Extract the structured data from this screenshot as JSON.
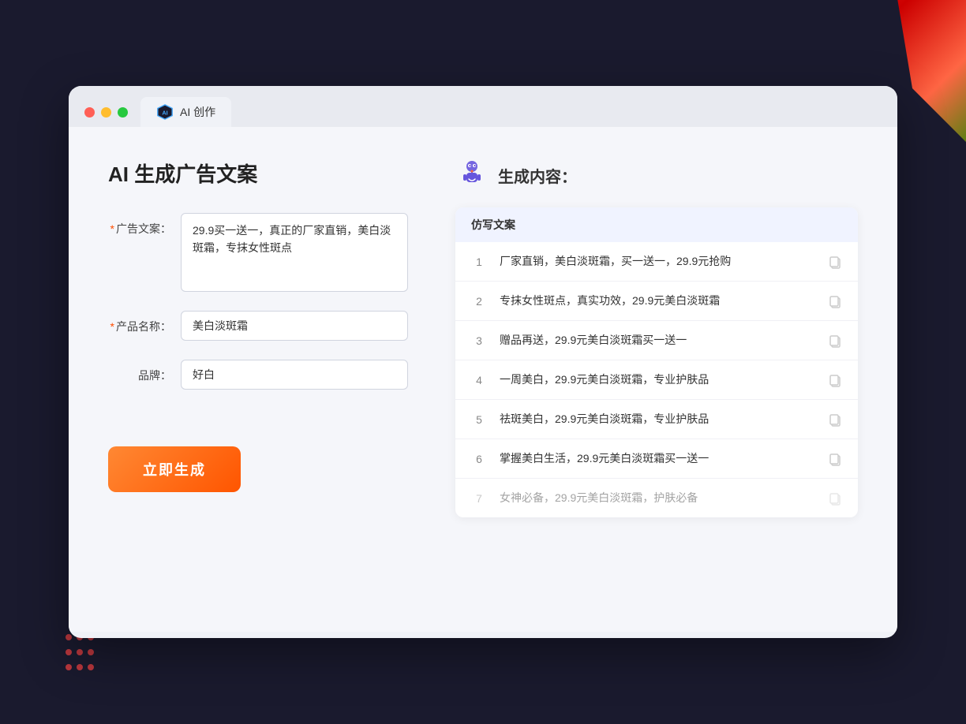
{
  "background": {
    "color": "#1a1a2e"
  },
  "browser": {
    "tab_label": "AI 创作",
    "traffic_lights": [
      "red",
      "yellow",
      "green"
    ]
  },
  "left_panel": {
    "title": "AI 生成广告文案",
    "form": {
      "ad_copy_label": "广告文案：",
      "ad_copy_required": "*",
      "ad_copy_value": "29.9买一送一，真正的厂家直销，美白淡斑霜，专抹女性斑点",
      "product_name_label": "产品名称：",
      "product_name_required": "*",
      "product_name_value": "美白淡斑霜",
      "brand_label": "品牌：",
      "brand_value": "好白"
    },
    "generate_button": "立即生成"
  },
  "right_panel": {
    "title": "生成内容：",
    "table_header": "仿写文案",
    "results": [
      {
        "num": "1",
        "text": "厂家直销，美白淡斑霜，买一送一，29.9元抢购",
        "dimmed": false
      },
      {
        "num": "2",
        "text": "专抹女性斑点，真实功效，29.9元美白淡斑霜",
        "dimmed": false
      },
      {
        "num": "3",
        "text": "赠品再送，29.9元美白淡斑霜买一送一",
        "dimmed": false
      },
      {
        "num": "4",
        "text": "一周美白，29.9元美白淡斑霜，专业护肤品",
        "dimmed": false
      },
      {
        "num": "5",
        "text": "祛斑美白，29.9元美白淡斑霜，专业护肤品",
        "dimmed": false
      },
      {
        "num": "6",
        "text": "掌握美白生活，29.9元美白淡斑霜买一送一",
        "dimmed": false
      },
      {
        "num": "7",
        "text": "女神必备，29.9元美白淡斑霜，护肤必备",
        "dimmed": true
      }
    ]
  }
}
